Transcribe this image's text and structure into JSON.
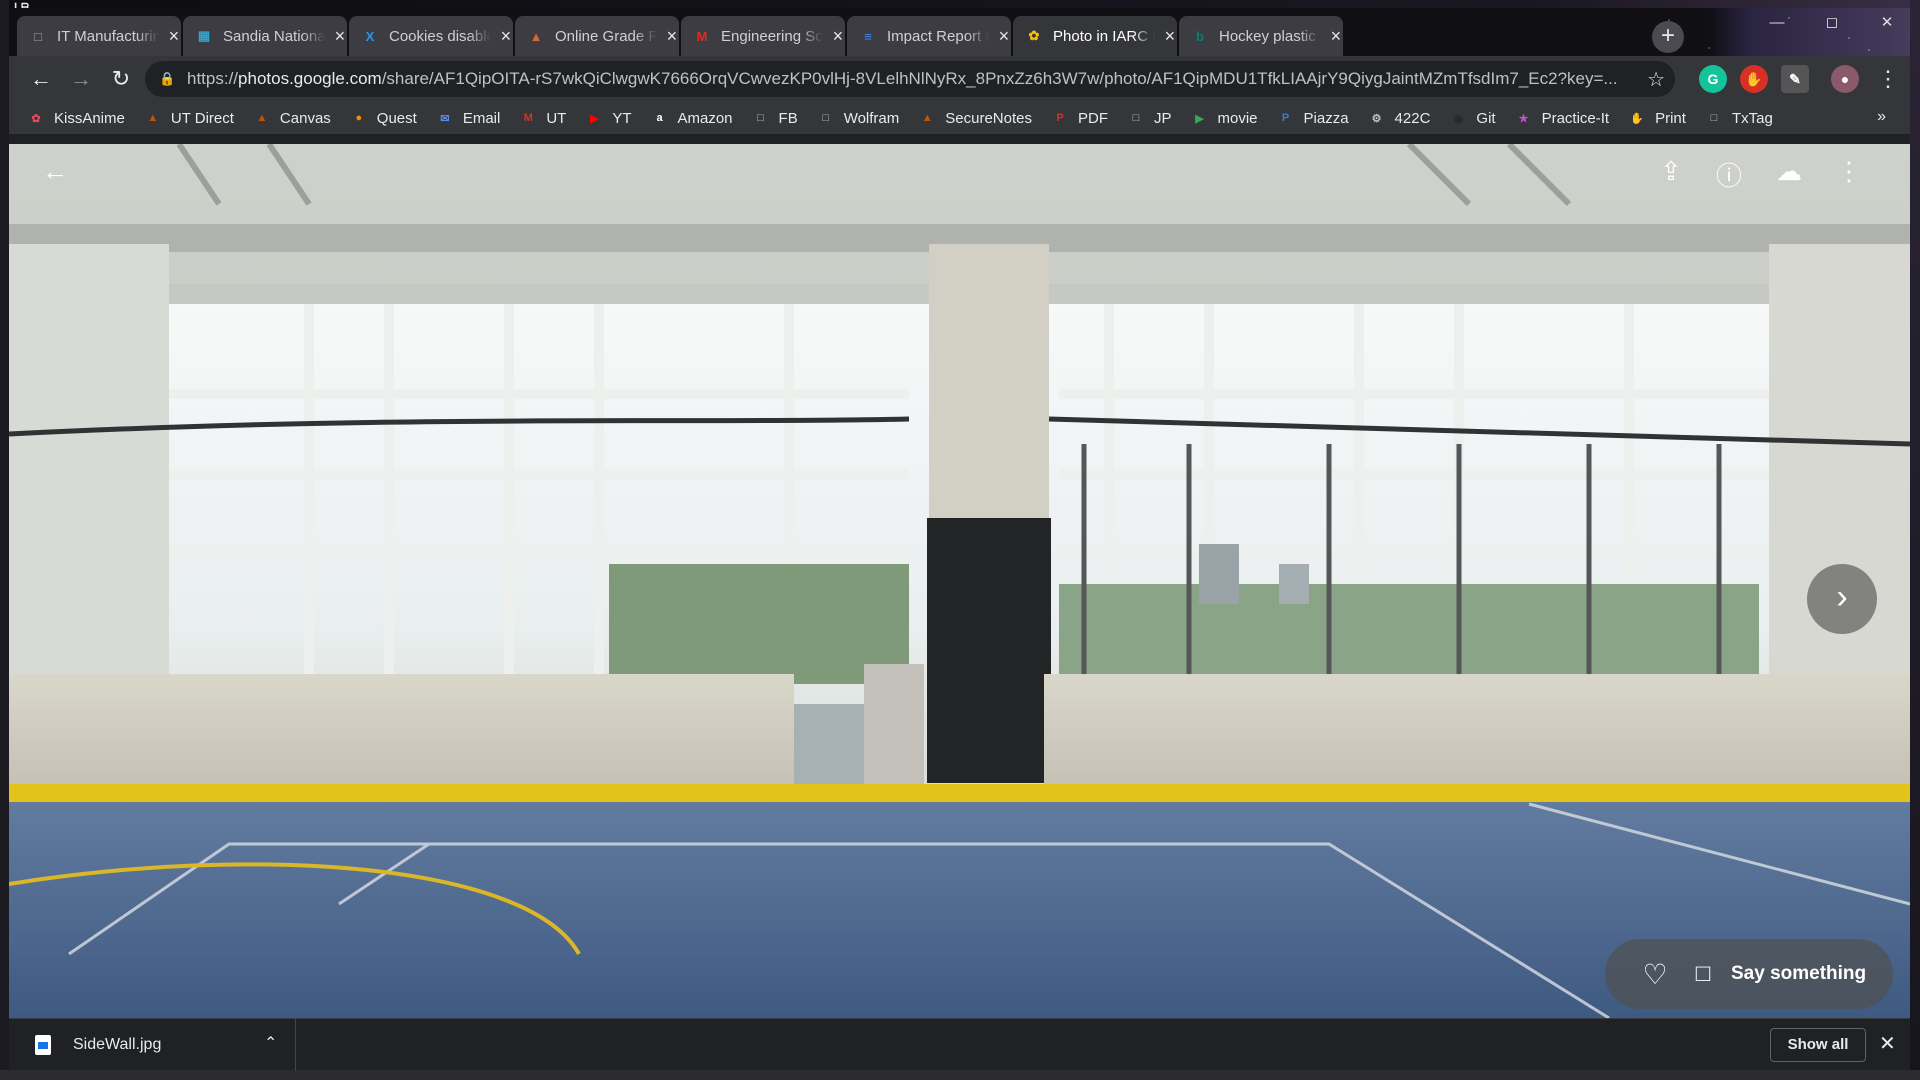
{
  "tabs": [
    {
      "title": "IT Manufacturing",
      "favicon": "page-icon",
      "color": "#9aa0a6"
    },
    {
      "title": "Sandia National Labs",
      "favicon": "sandia-icon",
      "color": "#35a2c9"
    },
    {
      "title": "Cookies disabled",
      "favicon": "x-icon",
      "color": "#1d9bf0"
    },
    {
      "title": "Online Grade Report",
      "favicon": "ut-icon",
      "color": "#d46a3a"
    },
    {
      "title": "Engineering School",
      "favicon": "gmail-icon",
      "color": "#d93025"
    },
    {
      "title": "Impact Report (Draft)",
      "favicon": "docs-icon",
      "color": "#4285f4"
    },
    {
      "title": "Photo in IARC Mission",
      "favicon": "photos-icon",
      "color": "#fbbc04"
    },
    {
      "title": "Hockey plastic panels",
      "favicon": "bing-icon",
      "color": "#008373"
    }
  ],
  "active_tab": 6,
  "address": {
    "prefix": "https://",
    "host": "photos.google.com",
    "path": "/share/AF1QipOITA-rS7wkQiClwgwK7666OrqVCwvezKP0vlHj-8VLelhNlNyRx_8PnxZz6h3W7w/photo/AF1QipMDU1TfkLIAAjrY9QiygJaintMZmTfsdIm7_Ec2?key=..."
  },
  "bookmarks": [
    {
      "label": "KissAnime",
      "icon": "kissanime-icon",
      "color": "#e84a5f"
    },
    {
      "label": "UT Direct",
      "icon": "ut-icon",
      "color": "#bf5700"
    },
    {
      "label": "Canvas",
      "icon": "canvas-icon",
      "color": "#bf5700"
    },
    {
      "label": "Quest",
      "icon": "quest-icon",
      "color": "#f29100"
    },
    {
      "label": "Email",
      "icon": "email-icon",
      "color": "#5b8def"
    },
    {
      "label": "UT",
      "icon": "gmail-icon",
      "color": "#d93025"
    },
    {
      "label": "YT",
      "icon": "youtube-icon",
      "color": "#ff0000"
    },
    {
      "label": "Amazon",
      "icon": "amazon-icon",
      "color": "#ffffff"
    },
    {
      "label": "FB",
      "icon": "page-icon",
      "color": "#bdc1c6"
    },
    {
      "label": "Wolfram",
      "icon": "page-icon",
      "color": "#bdc1c6"
    },
    {
      "label": "SecureNotes",
      "icon": "securenotes-icon",
      "color": "#bf5700"
    },
    {
      "label": "PDF",
      "icon": "pdf-icon",
      "color": "#d93025"
    },
    {
      "label": "JP",
      "icon": "page-icon",
      "color": "#bdc1c6"
    },
    {
      "label": "movie",
      "icon": "play-icon",
      "color": "#34a853"
    },
    {
      "label": "Piazza",
      "icon": "piazza-icon",
      "color": "#3e7cc0"
    },
    {
      "label": "422C",
      "icon": "422c-icon",
      "color": "#bdc1c6"
    },
    {
      "label": "Git",
      "icon": "github-icon",
      "color": "#24292e"
    },
    {
      "label": "Practice-It",
      "icon": "practiceit-icon",
      "color": "#c44fd6"
    },
    {
      "label": "Print",
      "icon": "print-icon",
      "color": "#f5b400"
    },
    {
      "label": "TxTag",
      "icon": "page-icon",
      "color": "#bdc1c6"
    }
  ],
  "viewer": {
    "say_something": "Say something"
  },
  "download": {
    "filename": "SideWall.jpg",
    "show_all": "Show all"
  },
  "colors": {
    "chrome_frame": "#35363a",
    "omnibox": "#202124",
    "floor_blue": "#3f5d86",
    "kickplate_yellow": "#e3c21a"
  }
}
